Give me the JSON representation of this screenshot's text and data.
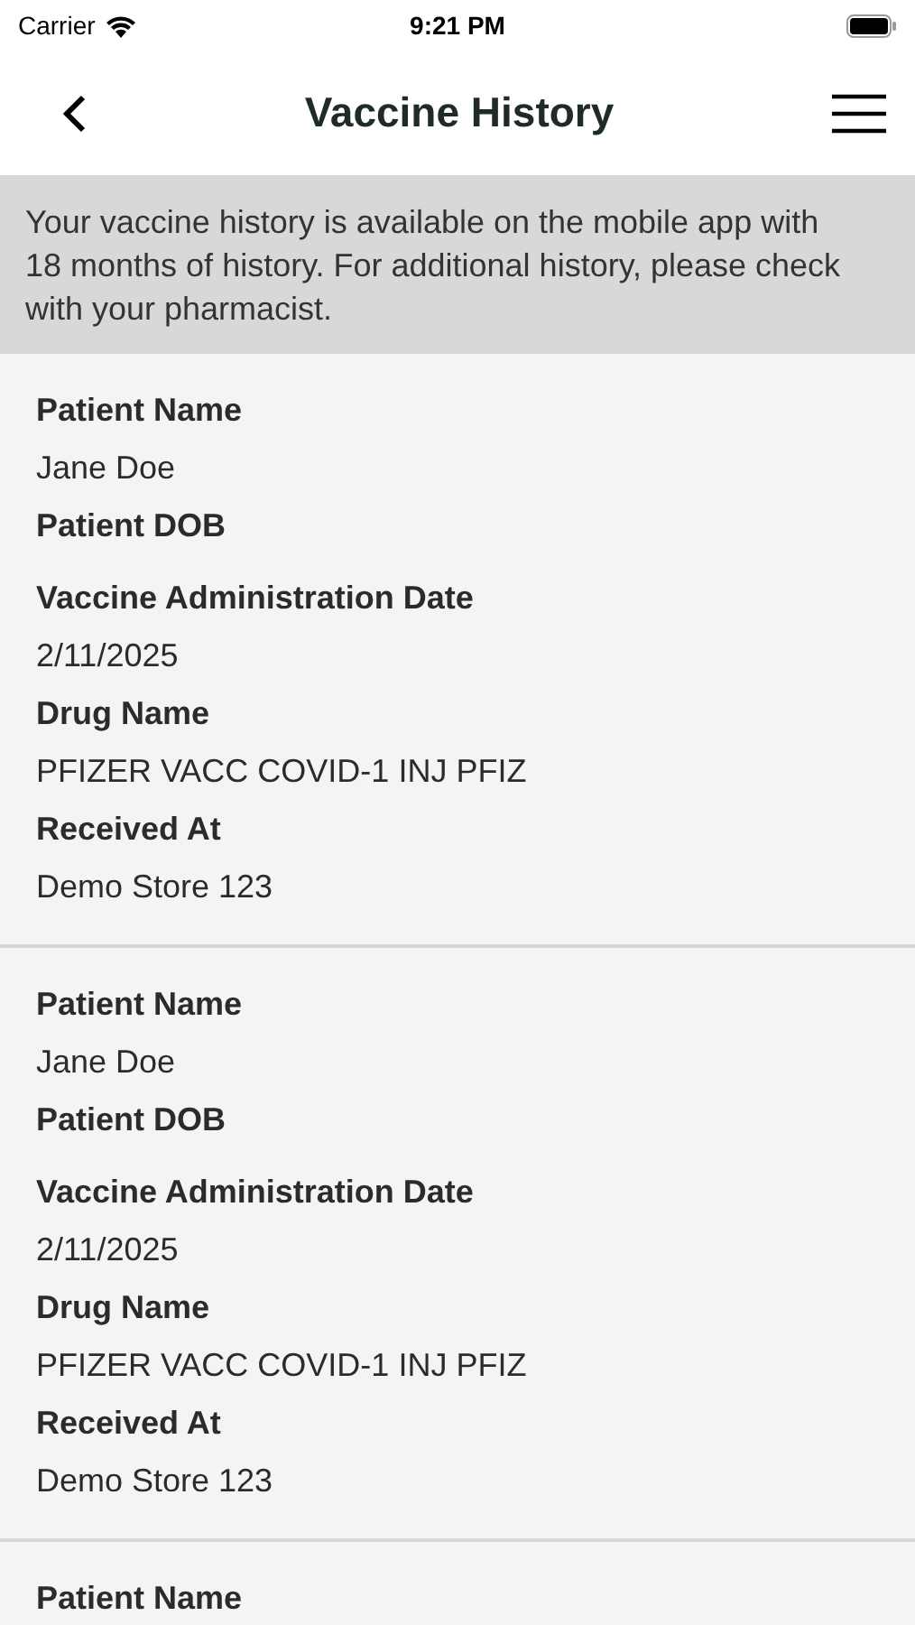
{
  "status_bar": {
    "carrier": "Carrier",
    "time": "9:21 PM"
  },
  "nav": {
    "title": "Vaccine History"
  },
  "banner": "Your vaccine history is available on the mobile app with 18 months of history. For additional history, please check with your pharmacist.",
  "records": [
    {
      "fields": [
        {
          "label": "Patient Name",
          "value": "Jane Doe"
        },
        {
          "label": "Patient DOB"
        },
        {
          "label": "Vaccine Administration Date",
          "value": "2/11/2025"
        },
        {
          "label": "Drug Name",
          "value": "PFIZER VACC COVID-1 INJ PFIZ"
        },
        {
          "label": "Received At",
          "value": "Demo Store 123"
        }
      ]
    },
    {
      "fields": [
        {
          "label": "Patient Name",
          "value": "Jane Doe"
        },
        {
          "label": "Patient DOB"
        },
        {
          "label": "Vaccine Administration Date",
          "value": "2/11/2025"
        },
        {
          "label": "Drug Name",
          "value": "PFIZER VACC COVID-1 INJ PFIZ"
        },
        {
          "label": "Received At",
          "value": "Demo Store 123"
        }
      ]
    },
    {
      "fields": [
        {
          "label": "Patient Name"
        }
      ]
    }
  ]
}
